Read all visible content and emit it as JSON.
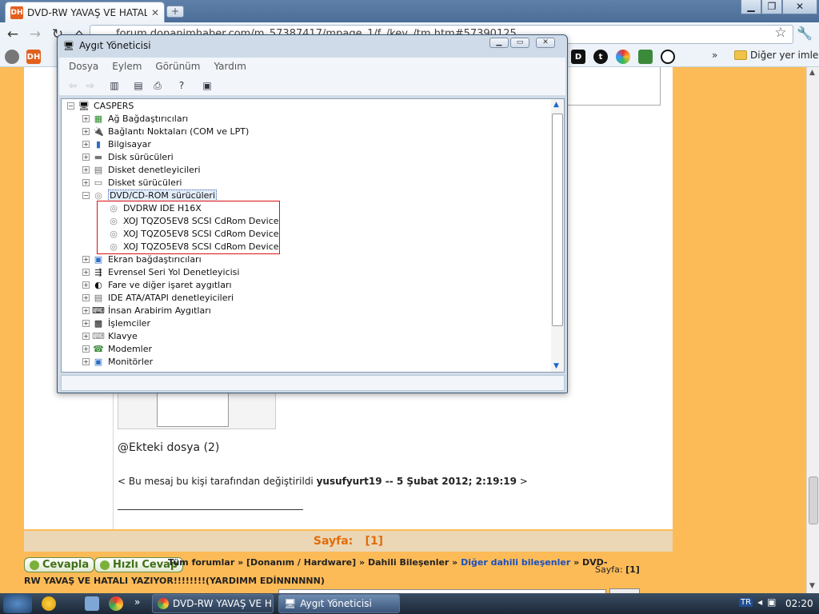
{
  "browser": {
    "tab_title": "DVD-RW YAVAŞ VE HATALI YA",
    "tab_favicon": "DH",
    "url": "forum.donanimhaber.com/m_57387417/mpage_1/f_/key_/tm.htm#57390125",
    "bookmarks_other": "Diğer yer imleri"
  },
  "devmgr": {
    "title": "Aygıt Yöneticisi",
    "menu": [
      "Dosya",
      "Eylem",
      "Görünüm",
      "Yardım"
    ],
    "root": "CASPERS",
    "categories": [
      "Ağ Bağdaştırıcıları",
      "Bağlantı Noktaları (COM ve LPT)",
      "Bilgisayar",
      "Disk sürücüleri",
      "Disket denetleyicileri",
      "Disket sürücüleri",
      "DVD/CD-ROM sürücüleri",
      "Ekran bağdaştırıcıları",
      "Evrensel Seri Yol Denetleyicisi",
      "Fare ve diğer işaret aygıtları",
      "IDE ATA/ATAPI denetleyicileri",
      "İnsan Arabirim Aygıtları",
      "İşlemciler",
      "Klavye",
      "Modemler",
      "Monitörler"
    ],
    "dvd_devices": [
      "DVDRW IDE H16X",
      "XOJ TQZO5EV8 SCSI CdRom Device",
      "XOJ TQZO5EV8 SCSI CdRom Device",
      "XOJ TQZO5EV8 SCSI CdRom Device"
    ]
  },
  "post": {
    "attachments": "Ekteki dosya (2)",
    "edit_prefix": "< Bu mesaj bu kişi tarafından değiştirildi ",
    "edit_user": "yusufyurt19",
    "edit_sep": " -- ",
    "edit_date": "5 Şubat 2012; 2:19:19",
    "edit_suffix": " >"
  },
  "pager": {
    "label": "Sayfa:",
    "current": "[1]"
  },
  "footer": {
    "reply": "Cevapla",
    "quick_reply": "Hızlı Cevap",
    "crumb_all": "Tüm forumlar",
    "crumb_hw": "[Donanım / Hardware]",
    "crumb_internal": "Dahili Bileşenler",
    "crumb_other": "Diğer dahili bileşenler",
    "crumb_thread_start": "DVD-",
    "crumb_thread_rest": "RW YAVAŞ VE HATALI YAZIYOR!!!!!!!!(YARDIMM EDİNNNNNN)",
    "page_label": "Sayfa:",
    "page_value": "[1]"
  },
  "taskbar": {
    "task1": "DVD-RW YAVAŞ VE H...",
    "task2": "Aygıt Yöneticisi",
    "lang": "TR",
    "clock": "02:20"
  },
  "colors": {
    "page_bg": "#fdbb57",
    "pager_text": "#e36c09",
    "link_blue": "#1a4fc0",
    "highlight_box": "#dd1111"
  }
}
